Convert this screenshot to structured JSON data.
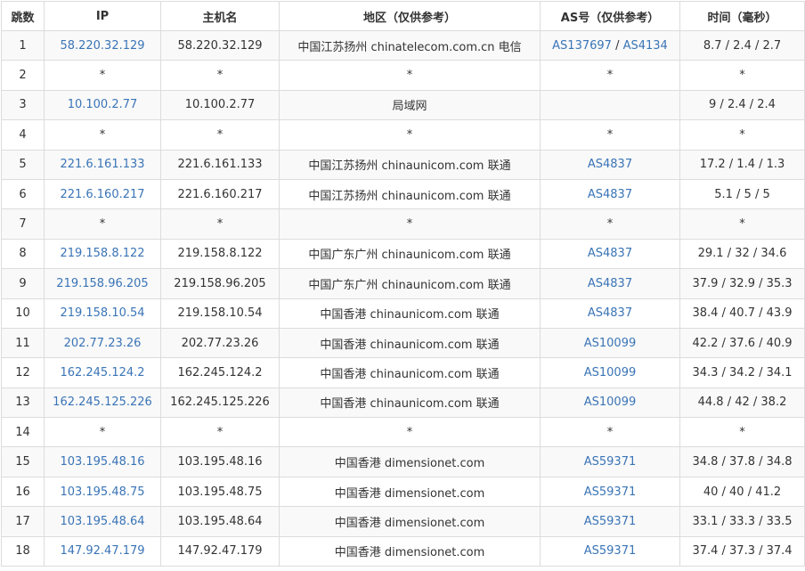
{
  "colors": {
    "link": "#3a74b6",
    "text": "#333333",
    "border": "#dcdcdc",
    "stripe": "#f9f9f9"
  },
  "headers": {
    "hop": "跳数",
    "ip": "IP",
    "hostname": "主机名",
    "region": "地区（仅供参考）",
    "as": "AS号（仅供参考）",
    "time": "时间（毫秒）"
  },
  "rows": [
    {
      "hop": "1",
      "ip": "58.220.32.129",
      "host": "58.220.32.129",
      "region": "中国江苏扬州 chinatelecom.com.cn 电信",
      "as": [
        "AS137697",
        "AS4134"
      ],
      "time": "8.7 / 2.4 / 2.7"
    },
    {
      "hop": "2",
      "ip": "*",
      "host": "*",
      "region": "*",
      "as": [
        "*"
      ],
      "time": "*"
    },
    {
      "hop": "3",
      "ip": "10.100.2.77",
      "host": "10.100.2.77",
      "region": "局域网",
      "as": [],
      "time": "9 / 2.4 / 2.4"
    },
    {
      "hop": "4",
      "ip": "*",
      "host": "*",
      "region": "*",
      "as": [
        "*"
      ],
      "time": "*"
    },
    {
      "hop": "5",
      "ip": "221.6.161.133",
      "host": "221.6.161.133",
      "region": "中国江苏扬州 chinaunicom.com 联通",
      "as": [
        "AS4837"
      ],
      "time": "17.2 / 1.4 / 1.3"
    },
    {
      "hop": "6",
      "ip": "221.6.160.217",
      "host": "221.6.160.217",
      "region": "中国江苏扬州 chinaunicom.com 联通",
      "as": [
        "AS4837"
      ],
      "time": "5.1 / 5 / 5"
    },
    {
      "hop": "7",
      "ip": "*",
      "host": "*",
      "region": "*",
      "as": [
        "*"
      ],
      "time": "*"
    },
    {
      "hop": "8",
      "ip": "219.158.8.122",
      "host": "219.158.8.122",
      "region": "中国广东广州 chinaunicom.com 联通",
      "as": [
        "AS4837"
      ],
      "time": "29.1 / 32 / 34.6"
    },
    {
      "hop": "9",
      "ip": "219.158.96.205",
      "host": "219.158.96.205",
      "region": "中国广东广州 chinaunicom.com 联通",
      "as": [
        "AS4837"
      ],
      "time": "37.9 / 32.9 / 35.3"
    },
    {
      "hop": "10",
      "ip": "219.158.10.54",
      "host": "219.158.10.54",
      "region": "中国香港 chinaunicom.com 联通",
      "as": [
        "AS4837"
      ],
      "time": "38.4 / 40.7 / 43.9"
    },
    {
      "hop": "11",
      "ip": "202.77.23.26",
      "host": "202.77.23.26",
      "region": "中国香港 chinaunicom.com 联通",
      "as": [
        "AS10099"
      ],
      "time": "42.2 / 37.6 / 40.9"
    },
    {
      "hop": "12",
      "ip": "162.245.124.2",
      "host": "162.245.124.2",
      "region": "中国香港 chinaunicom.com 联通",
      "as": [
        "AS10099"
      ],
      "time": "34.3 / 34.2 / 34.1"
    },
    {
      "hop": "13",
      "ip": "162.245.125.226",
      "host": "162.245.125.226",
      "region": "中国香港 chinaunicom.com 联通",
      "as": [
        "AS10099"
      ],
      "time": "44.8 / 42 / 38.2"
    },
    {
      "hop": "14",
      "ip": "*",
      "host": "*",
      "region": "*",
      "as": [
        "*"
      ],
      "time": "*"
    },
    {
      "hop": "15",
      "ip": "103.195.48.16",
      "host": "103.195.48.16",
      "region": "中国香港 dimensionet.com",
      "as": [
        "AS59371"
      ],
      "time": "34.8 / 37.8 / 34.8"
    },
    {
      "hop": "16",
      "ip": "103.195.48.75",
      "host": "103.195.48.75",
      "region": "中国香港 dimensionet.com",
      "as": [
        "AS59371"
      ],
      "time": "40 / 40 / 41.2"
    },
    {
      "hop": "17",
      "ip": "103.195.48.64",
      "host": "103.195.48.64",
      "region": "中国香港 dimensionet.com",
      "as": [
        "AS59371"
      ],
      "time": "33.1 / 33.3 / 33.5"
    },
    {
      "hop": "18",
      "ip": "147.92.47.179",
      "host": "147.92.47.179",
      "region": "中国香港 dimensionet.com",
      "as": [
        "AS59371"
      ],
      "time": "37.4 / 37.3 / 37.4"
    }
  ]
}
